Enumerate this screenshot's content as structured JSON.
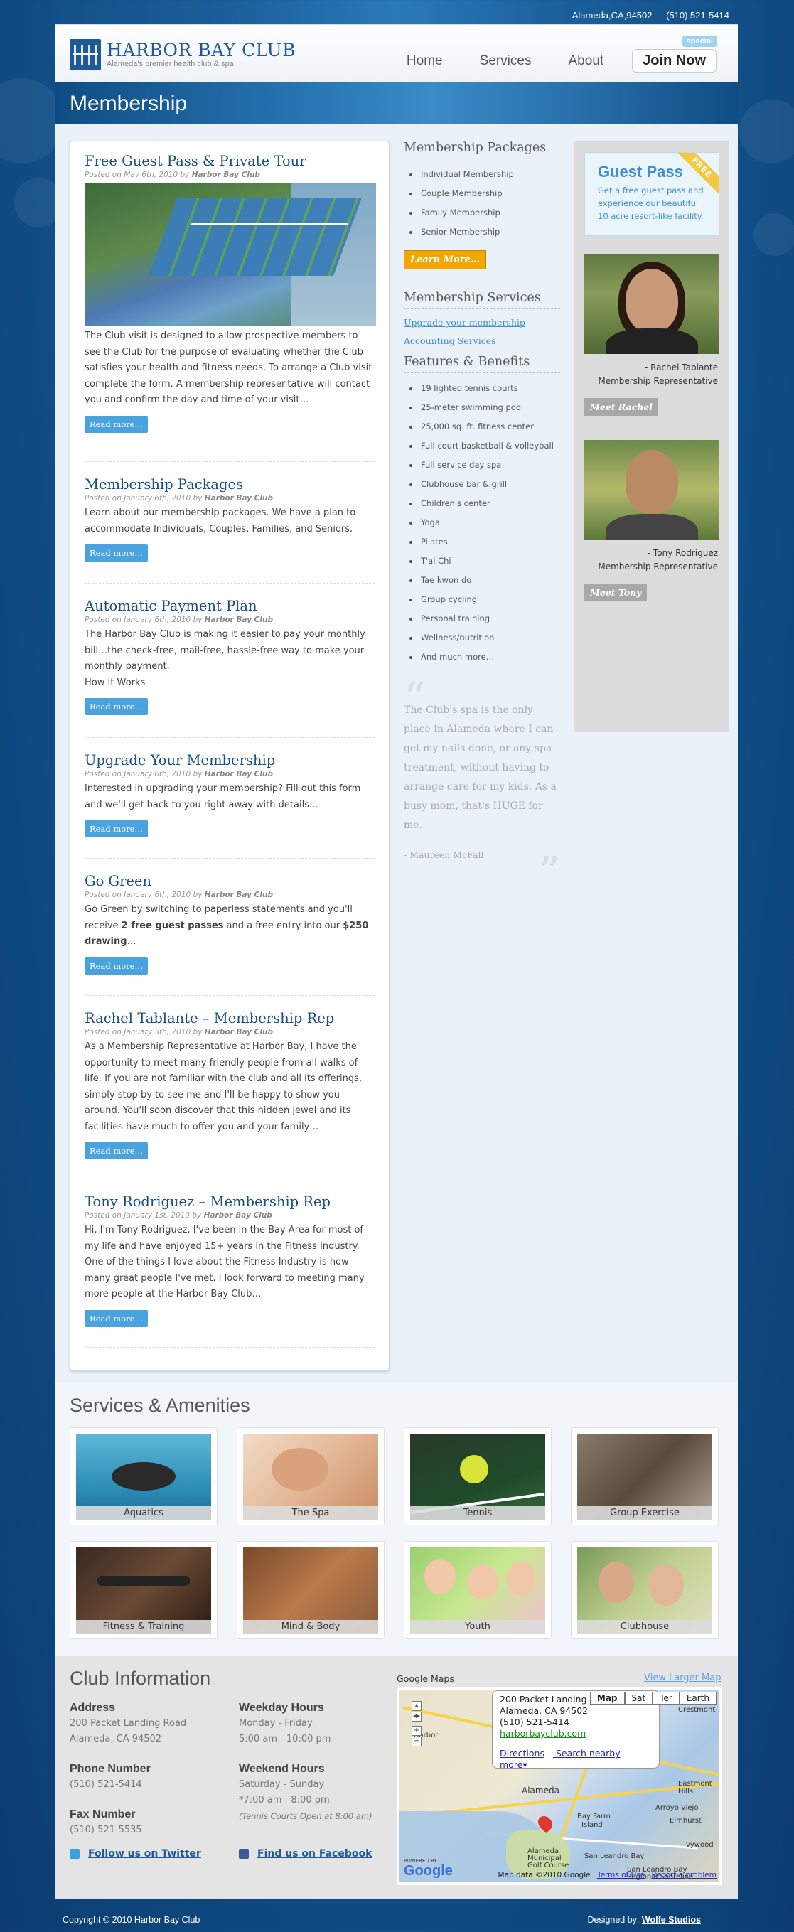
{
  "topbar": {
    "location": "Alameda,CA,94502",
    "phone": "(510) 521-5414"
  },
  "brand": {
    "title": "HARBOR BAY CLUB",
    "tagline": "Alameda's premier health club & spa"
  },
  "nav": {
    "home": "Home",
    "services": "Services",
    "about": "About",
    "join": "Join Now",
    "special": "special"
  },
  "banner": {
    "title": "Membership"
  },
  "posts": [
    {
      "title": "Free Guest Pass & Private Tour",
      "date": "Posted on May 6th, 2010 by",
      "author": "Harbor Bay Club",
      "body": "The Club visit is designed to allow prospective members to see the Club for the purpose of evaluating whether the Club satisfies your health and fitness needs. To arrange a Club visit complete the form. A membership representative will contact you and confirm the day and time of your visit…",
      "more": "Read more…"
    },
    {
      "title": "Membership Packages",
      "date": "Posted on January 6th, 2010 by",
      "author": "Harbor Bay Club",
      "body": "Learn about our membership packages. We have a plan to accommodate Individuals, Couples, Families, and Seniors.",
      "more": "Read more…"
    },
    {
      "title": "Automatic Payment Plan",
      "date": "Posted on January 6th, 2010 by",
      "author": "Harbor Bay Club",
      "body": "The Harbor Bay Club is making it easier to pay your monthly bill…the check-free, mail-free, hassle-free way to make your monthly payment.",
      "body2": "How It Works",
      "more": "Read more…"
    },
    {
      "title": "Upgrade Your Membership",
      "date": "Posted on January 6th, 2010 by",
      "author": "Harbor Bay Club",
      "body": "Interested in upgrading your membership? Fill out this form and we'll get back to you right away with details…",
      "more": "Read more…"
    },
    {
      "title": "Go Green",
      "date": "Posted on January 6th, 2010 by",
      "author": "Harbor Bay Club",
      "body_a": "Go Green by switching to paperless statements and you'll receive ",
      "body_b": "2 free guest passes",
      "body_c": " and a free entry into our ",
      "body_d": "$250 drawing",
      "body_e": "…",
      "more": "Read more…"
    },
    {
      "title": "Rachel Tablante – Membership Rep",
      "date": "Posted on January 5th, 2010 by",
      "author": "Harbor Bay Club",
      "body": "As a Membership Representative at Harbor Bay, I have the opportunity to meet many friendly people from all walks of life. If you are not familiar with the club and all its offerings, simply stop by to see me and I'll be happy to show you around. You'll soon discover that this hidden jewel and its facilities have much to offer you and your family…",
      "more": "Read more…"
    },
    {
      "title": "Tony Rodriguez – Membership Rep",
      "date": "Posted on January 1st, 2010 by",
      "author": "Harbor Bay Club",
      "body": "Hi, I'm Tony Rodriguez. I've been in the Bay Area for most of my life and have enjoyed 15+ years in the Fitness Industry. One of the things I love about the Fitness Industry is how many great people I've met. I look forward to meeting many more people at the Harbor Bay Club…",
      "more": "Read more…"
    }
  ],
  "packages": {
    "title": "Membership Packages",
    "items": [
      "Individual Membership",
      "Couple Membership",
      "Family Membership",
      "Senior Membership"
    ],
    "learn": "Learn More…"
  },
  "membership_services": {
    "title": "Membership Services",
    "links": [
      "Upgrade your membership",
      "Accounting Services"
    ]
  },
  "features": {
    "title": "Features & Benefits",
    "items": [
      "19 lighted tennis courts",
      "25-meter swimming pool",
      "25,000 sq. ft. fitness center",
      "Full court basketball & volleyball",
      "Full service day spa",
      "Clubhouse bar & grill",
      "Children's center",
      "Yoga",
      "Pilates",
      "T'ai Chi",
      "Tae kwon do",
      "Group cycling",
      "Personal training",
      "Wellness/nutrition",
      "And much more…"
    ]
  },
  "quote": {
    "text": "The Club's spa is the only place in Alameda where I can get my nails done, or any spa treatment, without having to arrange care for my kids. As a busy mom, that's HUGE for me.",
    "author": "- Maureen McFall"
  },
  "guest_pass": {
    "title": "Guest Pass",
    "badge": "FREE",
    "desc": "Get a  free guest pass and experience our beautiful 10 acre resort-like facility."
  },
  "reps": [
    {
      "name": "- Rachel Tablante",
      "role": "Membership Representative",
      "button": "Meet Rachel"
    },
    {
      "name": "- Tony Rodriguez",
      "role": "Membership Representative",
      "button": "Meet Tony"
    }
  ],
  "services": {
    "title": "Services & Amenities",
    "items": [
      "Aquatics",
      "The Spa",
      "Tennis",
      "Group Exercise",
      "Fitness & Training",
      "Mind & Body",
      "Youth",
      "Clubhouse"
    ]
  },
  "club_info": {
    "title": "Club Information",
    "address_label": "Address",
    "address1": "200 Packet Landing Road",
    "address2": "Alameda, CA 94502",
    "phone_label": "Phone Number",
    "phone": "(510) 521-5414",
    "fax_label": "Fax Number",
    "fax": "(510) 521-5535",
    "weekday_label": "Weekday Hours",
    "weekday_days": "Monday - Friday",
    "weekday_hours": "5:00 am - 10:00 pm",
    "weekend_label": "Weekend Hours",
    "weekend_days": "Saturday - Sunday",
    "weekend_hours": "*7:00 am - 8:00 pm",
    "weekend_note": "(Tennis Courts Open at 8:00 am)",
    "twitter": "Follow us on Twitter",
    "facebook": "Find us on Facebook"
  },
  "map": {
    "label": "Google Maps",
    "larger": "View Larger Map",
    "bubble_addr1": "200 Packet Landing Road",
    "bubble_addr2": "Alameda, CA 94502",
    "bubble_phone": "(510) 521-5414",
    "bubble_url": "harborbayclub.com",
    "directions": "Directions",
    "nearby": "Search nearby",
    "more": "more▾",
    "types": [
      "Map",
      "Sat",
      "Ter",
      "Earth"
    ],
    "data": "Map data ©2010 Google",
    "terms": "Terms of Use",
    "report": "Report a problem",
    "powered": "POWERED BY",
    "google": "Google",
    "places": [
      "Harbor",
      "Alameda",
      "Bay Farm",
      "Island",
      "San Leandro Bay",
      "Alameda Municipal Golf Course",
      "San Leandro Bay Regional Shoreline",
      "Eastmont Hills",
      "Arroyo Viejo",
      "Ivywood",
      "Crestmont",
      "Elmhurst"
    ]
  },
  "footer": {
    "copyright": "Copyright © 2010 Harbor Bay Club",
    "designed_label": "Designed by:",
    "designer": "Wolfe Studios"
  }
}
